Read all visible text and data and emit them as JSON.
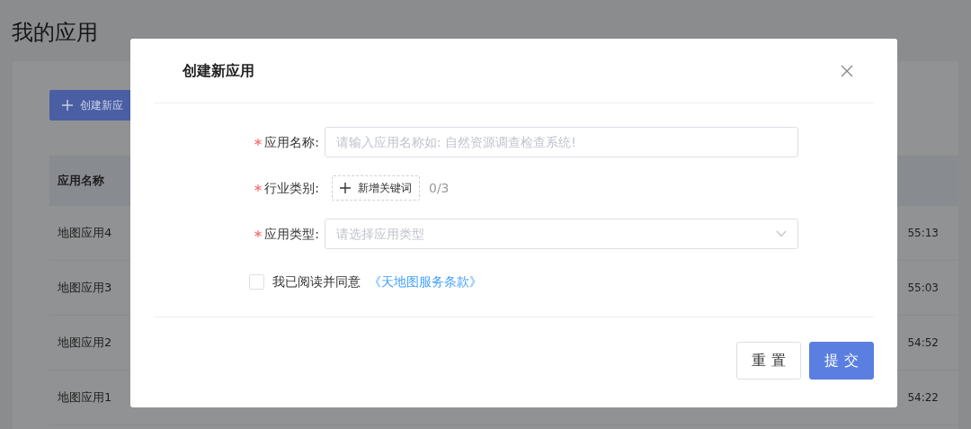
{
  "page": {
    "title": "我的应用"
  },
  "create_button": {
    "label": "创建新应"
  },
  "table": {
    "columns": [
      "应用名称"
    ],
    "rows": [
      {
        "name": "地图应用4",
        "column_2": "55:13"
      },
      {
        "name": "地图应用3",
        "column_2": "55:03"
      },
      {
        "name": "地图应用2",
        "column_2": "54:52"
      },
      {
        "name": "地图应用1",
        "column_2": "54:22"
      }
    ]
  },
  "dialog": {
    "title": "创建新应用",
    "fields": [
      {
        "kind": "text",
        "label": "应用名称:",
        "required": true,
        "placeholder": "请输入应用名称如: 自然资源调查检查系统!"
      },
      {
        "kind": "tags",
        "label": "行业类别:",
        "required": true,
        "button": "新增关键词",
        "count": "0/3"
      },
      {
        "kind": "select",
        "label": "应用类型:",
        "required": true,
        "placeholder": "请选择应用类型"
      }
    ],
    "agreement": {
      "checked": false,
      "text": "我已阅读并同意",
      "link": "《天地图服务条款》"
    },
    "buttons": [
      {
        "label": "重 置",
        "kind": "default"
      },
      {
        "label": "提 交",
        "kind": "primary"
      }
    ]
  }
}
